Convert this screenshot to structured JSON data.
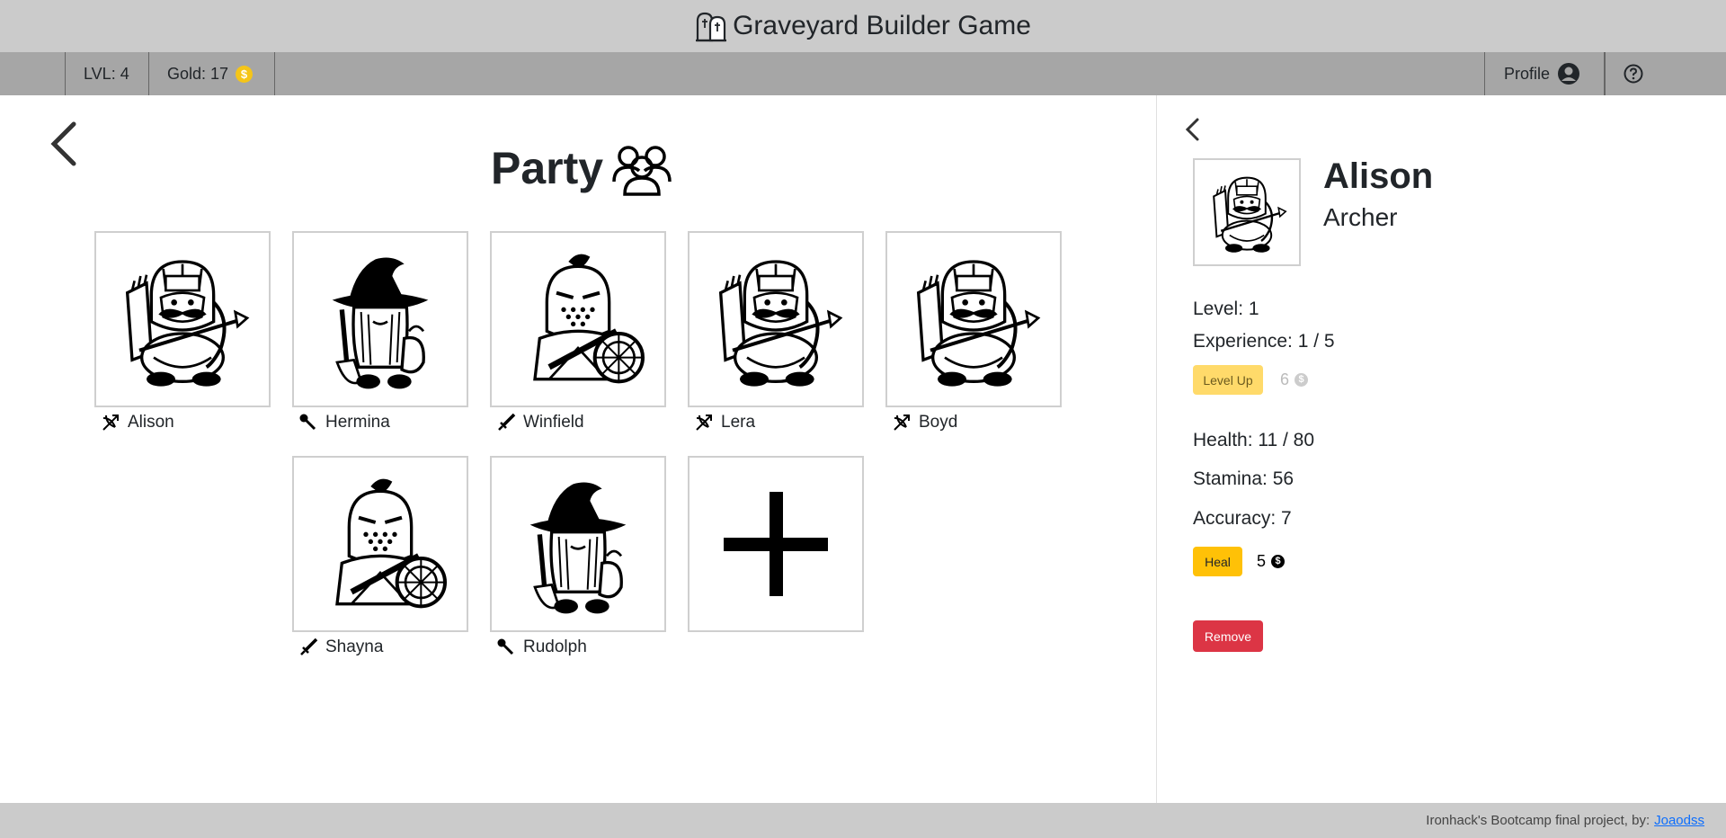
{
  "header": {
    "title": "Graveyard Builder Game",
    "logo_icon": "tombstones-icon"
  },
  "navbar": {
    "level": "LVL: 4",
    "gold": "Gold: 17",
    "gold_icon": "coin-icon",
    "profile_label": "Profile",
    "profile_icon": "user-circle-icon",
    "help_icon": "question-circle-icon"
  },
  "party": {
    "title": "Party",
    "title_icon": "people-group-icon",
    "members": [
      {
        "name": "Alison",
        "class_icon": "bow-icon",
        "portrait": "archer"
      },
      {
        "name": "Hermina",
        "class_icon": "wand-icon",
        "portrait": "wizard"
      },
      {
        "name": "Winfield",
        "class_icon": "sword-icon",
        "portrait": "knight"
      },
      {
        "name": "Lera",
        "class_icon": "bow-icon",
        "portrait": "archer"
      },
      {
        "name": "Boyd",
        "class_icon": "bow-icon",
        "portrait": "archer"
      },
      {
        "name": "Shayna",
        "class_icon": "sword-icon",
        "portrait": "knight"
      },
      {
        "name": "Rudolph",
        "class_icon": "wand-icon",
        "portrait": "wizard"
      }
    ],
    "add_icon": "plus-icon"
  },
  "detail": {
    "name": "Alison",
    "class": "Archer",
    "level": "Level: 1",
    "experience": "Experience: 1 / 5",
    "level_up_label": "Level Up",
    "level_up_cost": "6",
    "health": "Health: 11 / 80",
    "stamina": "Stamina: 56",
    "accuracy": "Accuracy: 7",
    "heal_label": "Heal",
    "heal_cost": "5",
    "remove_label": "Remove"
  },
  "footer": {
    "text": "Ironhack's Bootcamp final project, by:",
    "link": "Joaodss"
  },
  "colors": {
    "title_bg": "#cbcbcb",
    "nav_bg": "#a6a6a6",
    "gold": "#f5c518",
    "heal": "#ffc107",
    "level_up": "#ffda6a",
    "remove": "#dc3545"
  }
}
